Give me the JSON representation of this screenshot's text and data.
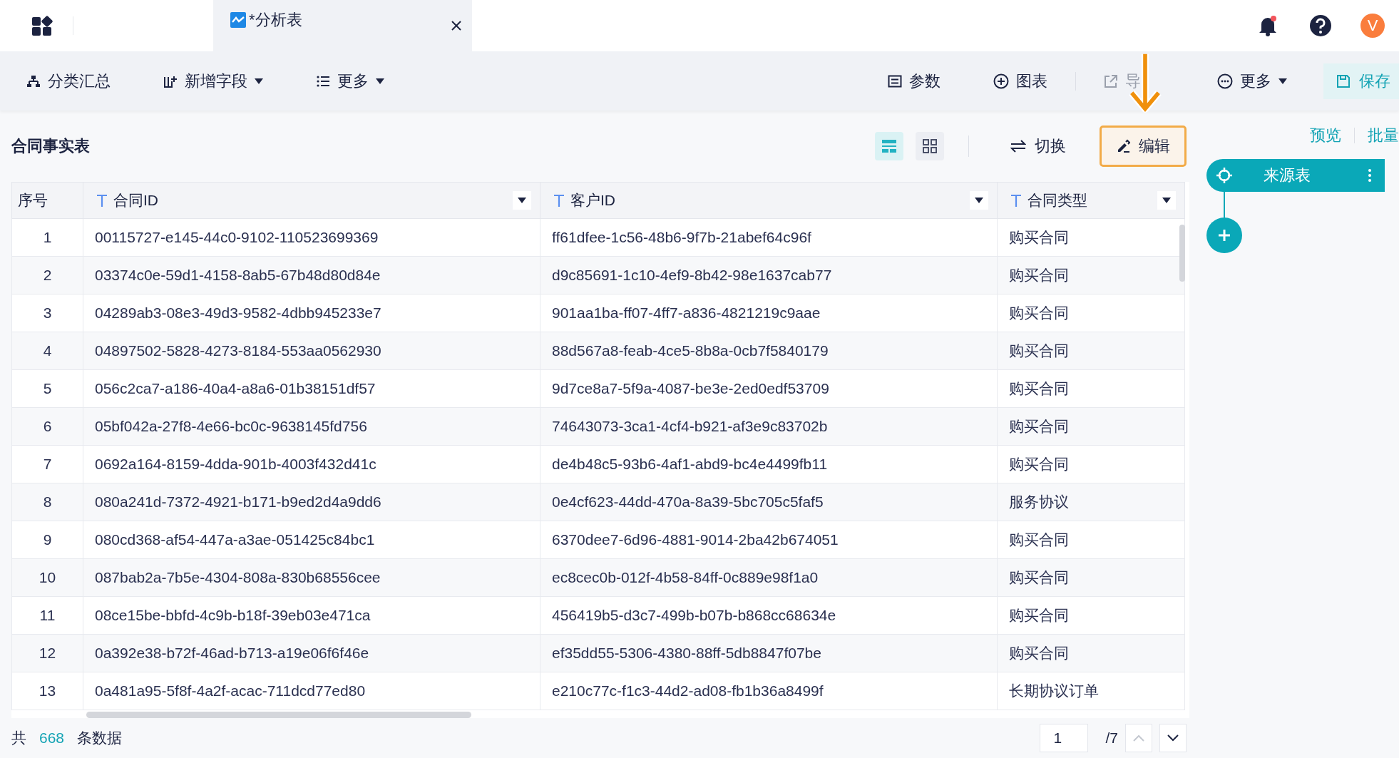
{
  "top_bar": {
    "tabs": [
      {
        "title": "*分析表",
        "selected": true
      }
    ],
    "bell": {
      "unread": true
    },
    "avatar": "V"
  },
  "toolbar": {
    "left": [
      {
        "label": "分类汇总",
        "dropdown": false
      },
      {
        "label": "新增字段",
        "dropdown": true
      },
      {
        "label": "更多",
        "dropdown": true
      }
    ],
    "right": [
      {
        "label": "参数",
        "dropdown": false,
        "disabled": false
      },
      {
        "label": "图表",
        "dropdown": false,
        "disabled": false
      },
      {
        "label": "导",
        "dropdown": false,
        "disabled": true
      },
      {
        "label": "更多",
        "dropdown": true,
        "disabled": false
      }
    ],
    "save": "保存"
  },
  "table_title": "合同事实表",
  "view_toggles": [
    {
      "selected": true
    },
    {
      "selected": false
    }
  ],
  "switch_button": "切换",
  "edit_button": {
    "label": "编辑",
    "highlighted": true
  },
  "table": {
    "columns": [
      {
        "label": "序号",
        "kind": "index"
      },
      {
        "label": "合同ID",
        "kind": "text"
      },
      {
        "label": "客户ID",
        "kind": "text"
      },
      {
        "label": "合同类型",
        "kind": "text"
      }
    ],
    "rows": [
      [
        "1",
        "00115727-e145-44c0-9102-110523699369",
        "ff61dfee-1c56-48b6-9f7b-21abef64c96f",
        "购买合同"
      ],
      [
        "2",
        "03374c0e-59d1-4158-8ab5-67b48d80d84e",
        "d9c85691-1c10-4ef9-8b42-98e1637cab77",
        "购买合同"
      ],
      [
        "3",
        "04289ab3-08e3-49d3-9582-4dbb945233e7",
        "901aa1ba-ff07-4ff7-a836-4821219c9aae",
        "购买合同"
      ],
      [
        "4",
        "04897502-5828-4273-8184-553aa0562930",
        "88d567a8-feab-4ce5-8b8a-0cb7f5840179",
        "购买合同"
      ],
      [
        "5",
        "056c2ca7-a186-40a4-a8a6-01b38151df57",
        "9d7ce8a7-5f9a-4087-be3e-2ed0edf53709",
        "购买合同"
      ],
      [
        "6",
        "05bf042a-27f8-4e66-bc0c-9638145fd756",
        "74643073-3ca1-4cf4-b921-af3e9c83702b",
        "购买合同"
      ],
      [
        "7",
        "0692a164-8159-4dda-901b-4003f432d41c",
        "de4b48c5-93b6-4af1-abd9-bc4e4499fb11",
        "购买合同"
      ],
      [
        "8",
        "080a241d-7372-4921-b171-b9ed2d4a9dd6",
        "0e4cf623-44dd-470a-8a39-5bc705c5faf5",
        "服务协议"
      ],
      [
        "9",
        "080cd368-af54-447a-a3ae-051425c84bc1",
        "6370dee7-6d96-4881-9014-2ba42b674051",
        "购买合同"
      ],
      [
        "10",
        "087bab2a-7b5e-4304-808a-830b68556cee",
        "ec8cec0b-012f-4b58-84ff-0c889e98f1a0",
        "购买合同"
      ],
      [
        "11",
        "08ce15be-bbfd-4c9b-b18f-39eb03e471ca",
        "456419b5-d3c7-499b-b07b-b868cc68634e",
        "购买合同"
      ],
      [
        "12",
        "0a392e38-b72f-46ad-b713-a19e06f6f46e",
        "ef35dd55-5306-4380-88ff-5db8847f07be",
        "购买合同"
      ],
      [
        "13",
        "0a481a95-5f8f-4a2f-acac-711dcd77ed80",
        "e210c77c-f1c3-44d2-ad08-fb1b36a8499f",
        "长期协议订单"
      ]
    ]
  },
  "footer": {
    "prefix": "共",
    "total": "668",
    "suffix": "条数据",
    "page": "1",
    "page_total": "/7"
  },
  "side_panel": {
    "links": [
      "预览",
      "批量"
    ],
    "node": "来源表"
  }
}
